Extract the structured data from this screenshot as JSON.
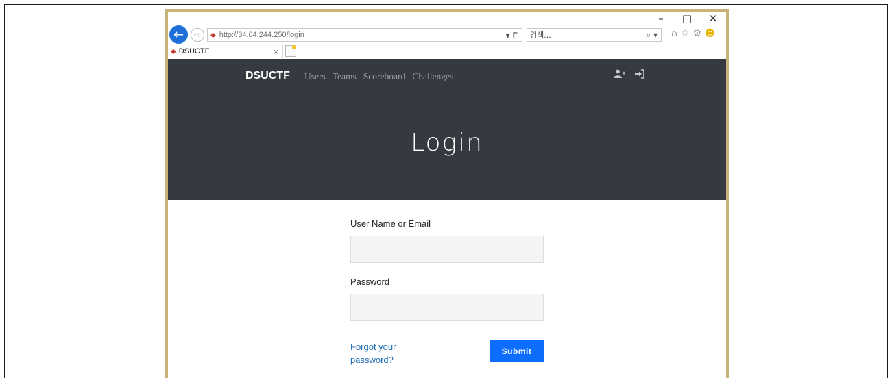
{
  "window_controls": {
    "minimize": "–",
    "maximize": "□",
    "close": "✕"
  },
  "nav": {
    "back_icon": "←",
    "forward_icon": "⇨",
    "url": "http://34.64.244.250/login",
    "address_tools": "▾ Ꞇ",
    "search_placeholder": "검색...",
    "search_tools": "⌕ ▾"
  },
  "tab": {
    "title": "DSUCTF",
    "close": "×"
  },
  "site": {
    "brand": "DSUCTF",
    "links": [
      "Users",
      "Teams",
      "Scoreboard",
      "Challenges"
    ],
    "page_title": "Login"
  },
  "form": {
    "username_label": "User Name or Email",
    "username_value": "",
    "password_label": "Password",
    "password_value": "",
    "forgot_text": "Forgot your password?",
    "submit_label": "Submit"
  },
  "colors": {
    "window_border": "#c7b37a",
    "navbar_bg": "#343a40",
    "primary": "#0d6efd",
    "link": "#1f6fb5"
  }
}
